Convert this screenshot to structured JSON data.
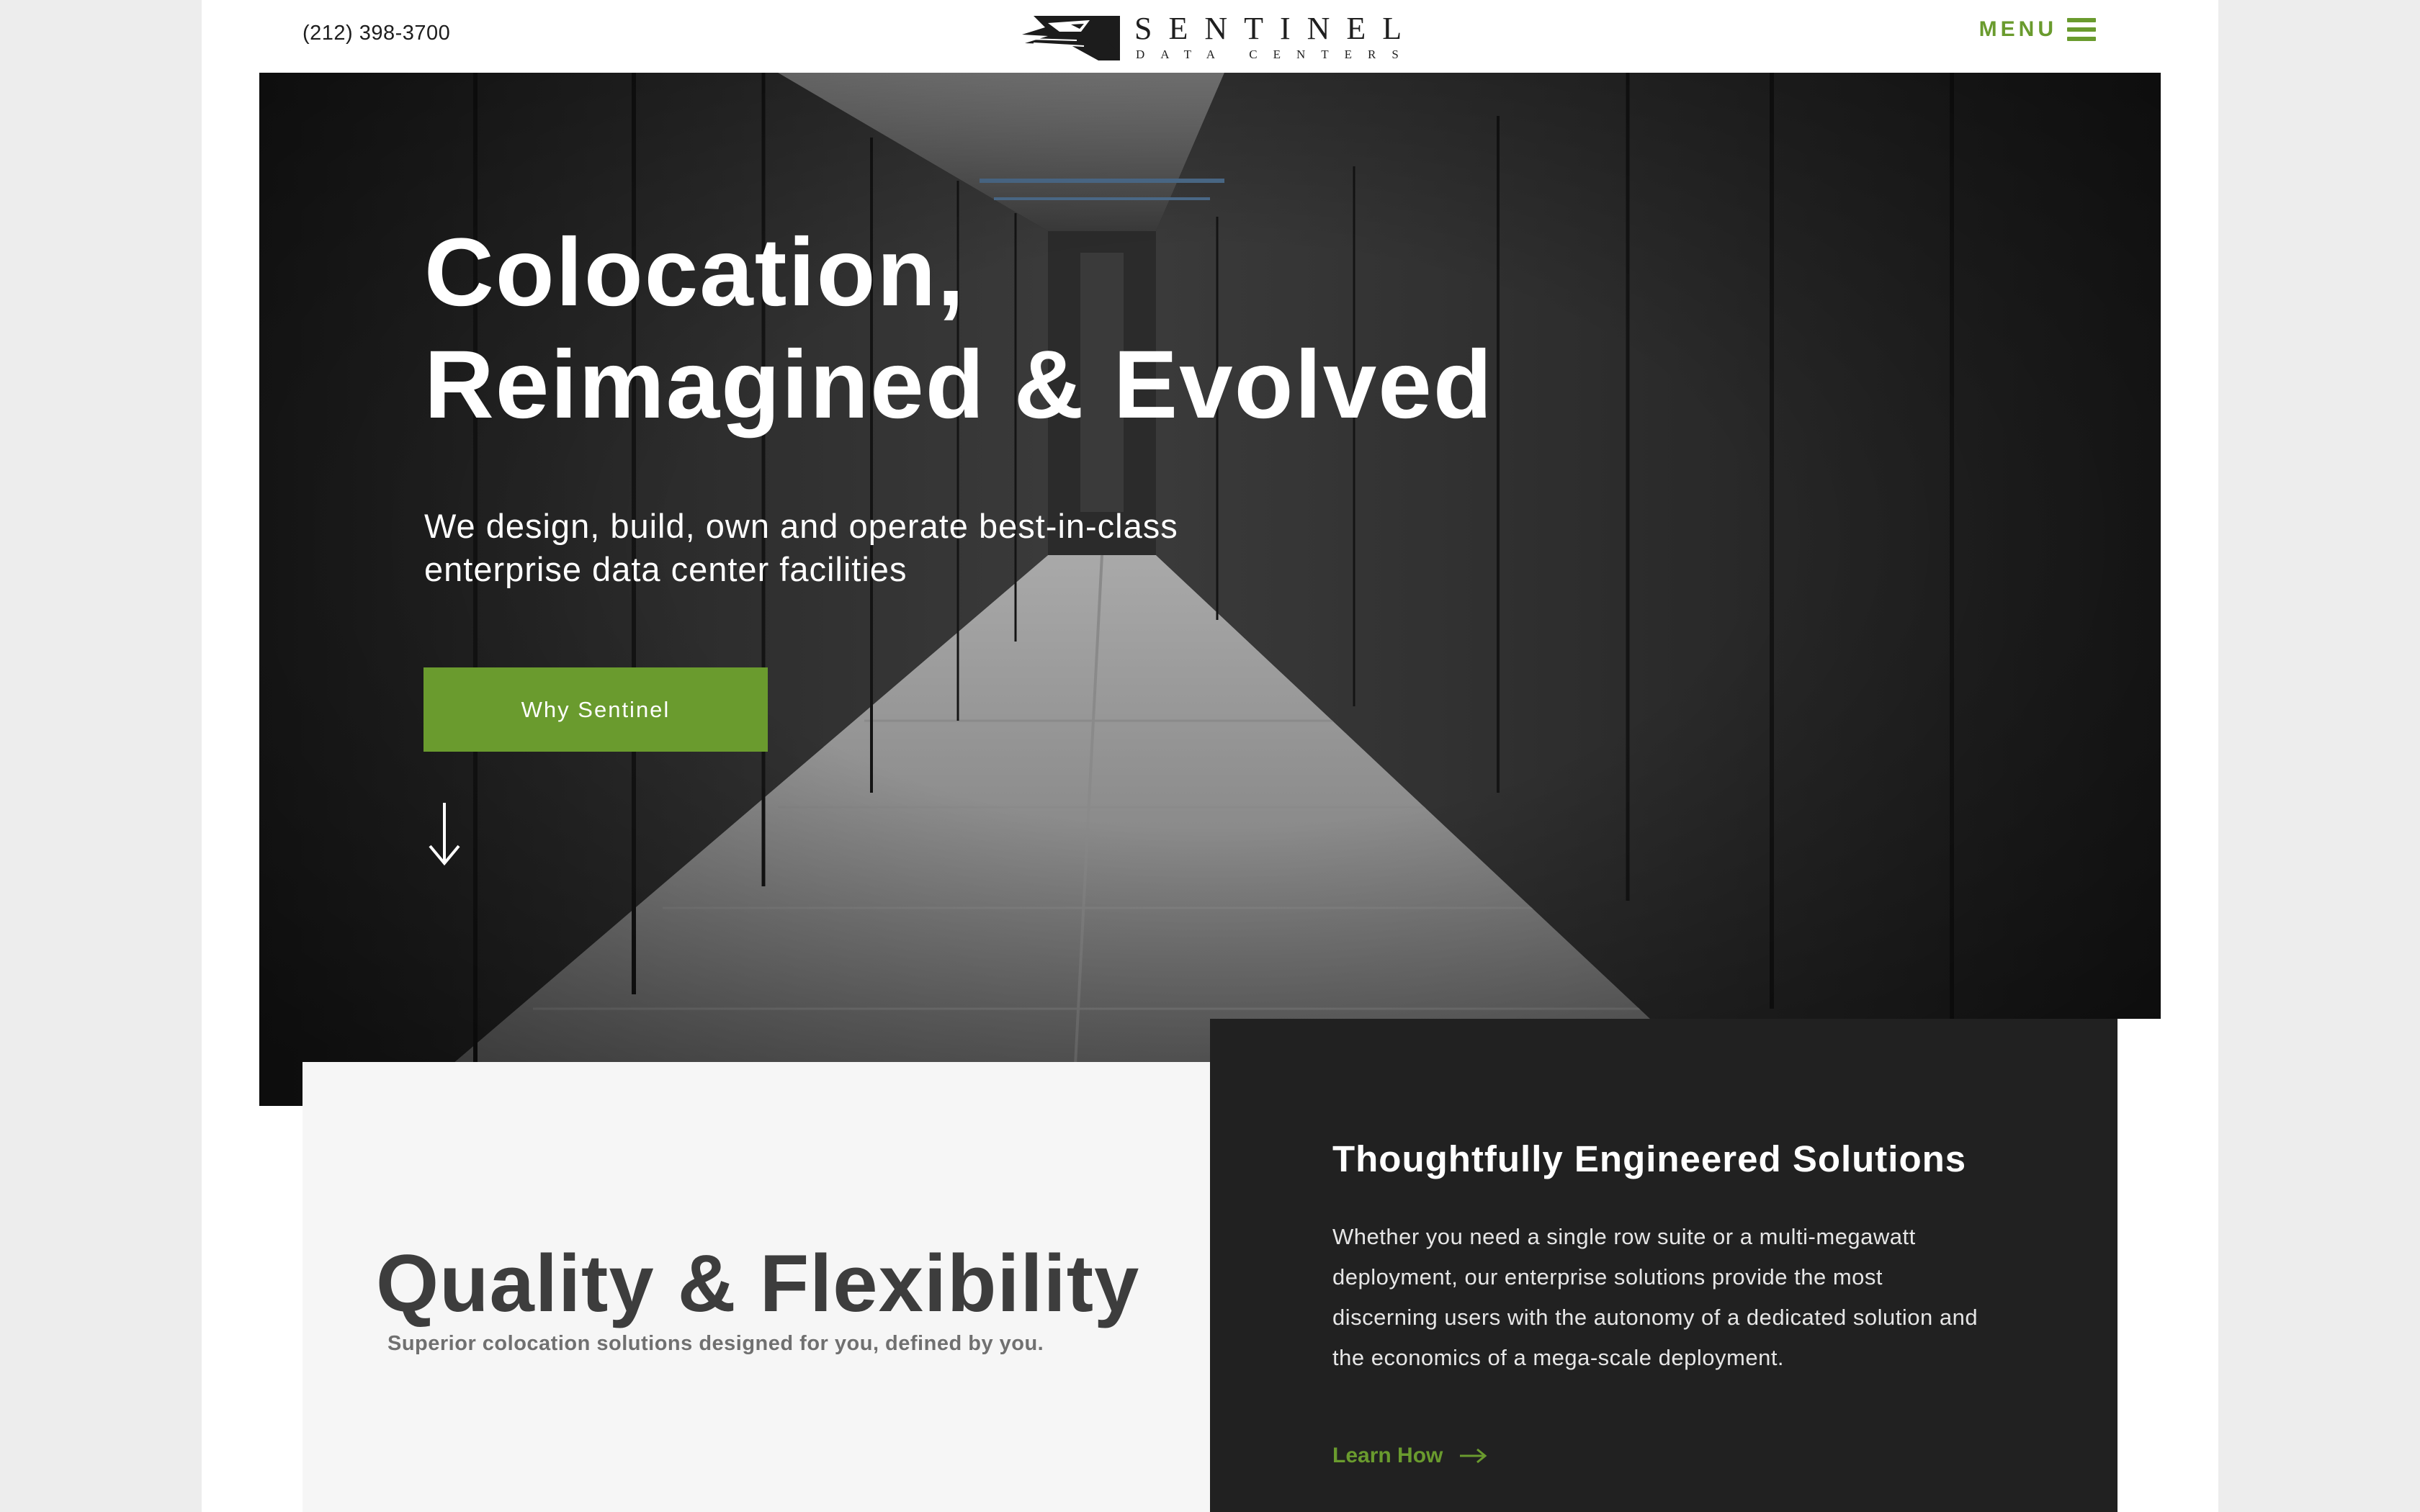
{
  "header": {
    "phone": "(212) 398-3700",
    "logo": {
      "title": "SENTINEL",
      "subtitle": "DATA CENTERS"
    },
    "menu_label": "MENU",
    "menu_icon": "hamburger-icon"
  },
  "hero": {
    "title_line1": "Colocation,",
    "title_line2": "Reimagined & Evolved",
    "subtitle_line1": "We design, build, own and operate best-in-class",
    "subtitle_line2": "enterprise data center facilities",
    "cta_label": "Why Sentinel",
    "scroll_icon": "arrow-down-icon"
  },
  "quality": {
    "title": "Quality & Flexibility",
    "subtitle": "Superior colocation solutions designed for you, defined by you."
  },
  "solutions": {
    "title": "Thoughtfully Engineered Solutions",
    "body_line1": "Whether you need a single row suite or a multi-megawatt",
    "body_line2": "deployment, our enterprise solutions provide the most",
    "body_line3": "discerning users with the autonomy of a dedicated solution and",
    "body_line4": "the economics of a mega-scale deployment.",
    "link_label": "Learn How",
    "link_icon": "arrow-right-icon"
  },
  "colors": {
    "accent_green": "#6a9b2e",
    "dark_panel": "#212121",
    "light_panel": "#f6f6f6",
    "text_dark": "#3d3d3d"
  }
}
